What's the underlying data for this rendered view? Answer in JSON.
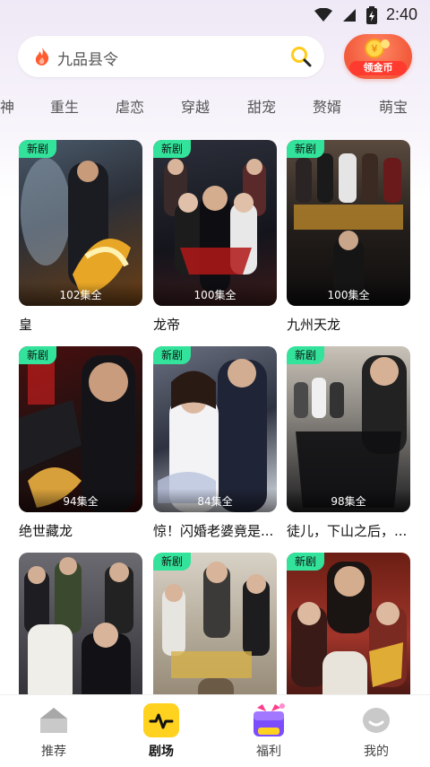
{
  "status": {
    "time": "2:40"
  },
  "search": {
    "text": "九品县令"
  },
  "coin_button": {
    "label": "领金币"
  },
  "categories": [
    "神",
    "重生",
    "虐恋",
    "穿越",
    "甜宠",
    "赘婿",
    "萌宝"
  ],
  "cards": [
    {
      "badge": "新剧",
      "episodes": "102集全",
      "title": "皇"
    },
    {
      "badge": "新剧",
      "episodes": "100集全",
      "title": "龙帝"
    },
    {
      "badge": "新剧",
      "episodes": "100集全",
      "title": "九州天龙"
    },
    {
      "badge": "新剧",
      "episodes": "94集全",
      "title": "绝世藏龙"
    },
    {
      "badge": "新剧",
      "episodes": "84集全",
      "title": "惊！闪婚老婆竟是..."
    },
    {
      "badge": "新剧",
      "episodes": "98集全",
      "title": "徒儿，下山之后，..."
    },
    {
      "badge": "",
      "episodes": "",
      "title": ""
    },
    {
      "badge": "新剧",
      "episodes": "",
      "title": ""
    },
    {
      "badge": "新剧",
      "episodes": "",
      "title": ""
    }
  ],
  "nav": {
    "recommend": "推荐",
    "theater": "剧场",
    "welfare": "福利",
    "mine": "我的"
  },
  "colors": {
    "badge": "#33e39b",
    "accent_yellow": "#ffd21f",
    "coin_red": "#f25b3c"
  }
}
